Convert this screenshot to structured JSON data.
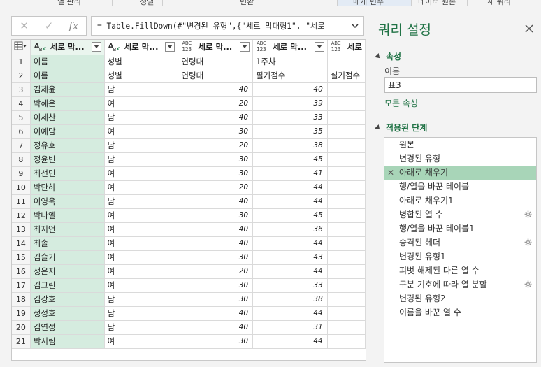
{
  "ribbon": {
    "labels": [
      "열 관리",
      "정렬",
      "변환",
      "매개 변수",
      "데이터 원본",
      "새 쿼리"
    ]
  },
  "formula_bar": {
    "text": "= Table.FillDown(#\"변경된 유형\",{\"세로 막대형1\", \"세로"
  },
  "grid": {
    "columns": [
      {
        "type": "abc",
        "name": "세로 막..."
      },
      {
        "type": "abc",
        "name": "세로 막..."
      },
      {
        "type": "abc123",
        "name": "세로 막..."
      },
      {
        "type": "abc123",
        "name": "세로 막..."
      },
      {
        "type": "abc123",
        "name": "세로"
      }
    ],
    "rows": [
      [
        "1",
        "이름",
        "성별",
        "연령대",
        "1주차",
        ""
      ],
      [
        "2",
        "이름",
        "성별",
        "연령대",
        "필기점수",
        "실기점수"
      ],
      [
        "3",
        "김제윤",
        "남",
        "40",
        "40",
        ""
      ],
      [
        "4",
        "박혜은",
        "여",
        "20",
        "39",
        ""
      ],
      [
        "5",
        "이세찬",
        "남",
        "40",
        "33",
        ""
      ],
      [
        "6",
        "이예담",
        "여",
        "30",
        "35",
        ""
      ],
      [
        "7",
        "정유호",
        "남",
        "20",
        "38",
        ""
      ],
      [
        "8",
        "정윤빈",
        "남",
        "30",
        "45",
        ""
      ],
      [
        "9",
        "최선민",
        "여",
        "30",
        "41",
        ""
      ],
      [
        "10",
        "박단하",
        "여",
        "20",
        "44",
        ""
      ],
      [
        "11",
        "이영욱",
        "남",
        "40",
        "44",
        ""
      ],
      [
        "12",
        "박나엘",
        "여",
        "30",
        "45",
        ""
      ],
      [
        "13",
        "최지언",
        "여",
        "40",
        "36",
        ""
      ],
      [
        "14",
        "최솔",
        "여",
        "40",
        "44",
        ""
      ],
      [
        "15",
        "김슬기",
        "여",
        "30",
        "43",
        ""
      ],
      [
        "16",
        "정은지",
        "여",
        "20",
        "44",
        ""
      ],
      [
        "17",
        "김그린",
        "여",
        "30",
        "33",
        ""
      ],
      [
        "18",
        "김강호",
        "남",
        "30",
        "38",
        ""
      ],
      [
        "19",
        "정정호",
        "남",
        "40",
        "44",
        ""
      ],
      [
        "20",
        "김연성",
        "남",
        "40",
        "31",
        ""
      ],
      [
        "21",
        "박서림",
        "여",
        "30",
        "44",
        ""
      ]
    ]
  },
  "panel": {
    "title": "쿼리 설정",
    "properties_label": "속성",
    "name_label": "이름",
    "name_value": "표3",
    "all_properties_link": "모든 속성",
    "applied_steps_label": "적용된 단계",
    "steps": [
      {
        "label": "원본",
        "gear": false,
        "active": false
      },
      {
        "label": "변경된 유형",
        "gear": false,
        "active": false
      },
      {
        "label": "아래로 채우기",
        "gear": false,
        "active": true
      },
      {
        "label": "행/열을 바꾼 테이블",
        "gear": false,
        "active": false
      },
      {
        "label": "아래로 채우기1",
        "gear": false,
        "active": false
      },
      {
        "label": "병합된 열 수",
        "gear": true,
        "active": false
      },
      {
        "label": "행/열을 바꾼 테이블1",
        "gear": false,
        "active": false
      },
      {
        "label": "승격된 헤더",
        "gear": true,
        "active": false
      },
      {
        "label": "변경된 유형1",
        "gear": false,
        "active": false
      },
      {
        "label": "피벗 해제된 다른 열 수",
        "gear": false,
        "active": false
      },
      {
        "label": "구분 기호에 따라 열 분할",
        "gear": true,
        "active": false
      },
      {
        "label": "변경된 유형2",
        "gear": false,
        "active": false
      },
      {
        "label": "이름을 바꾼 열 수",
        "gear": false,
        "active": false
      }
    ]
  },
  "colors": {
    "accent": "#217346",
    "selected_column": "#d5ecdf",
    "active_step": "#a8d5b8"
  }
}
